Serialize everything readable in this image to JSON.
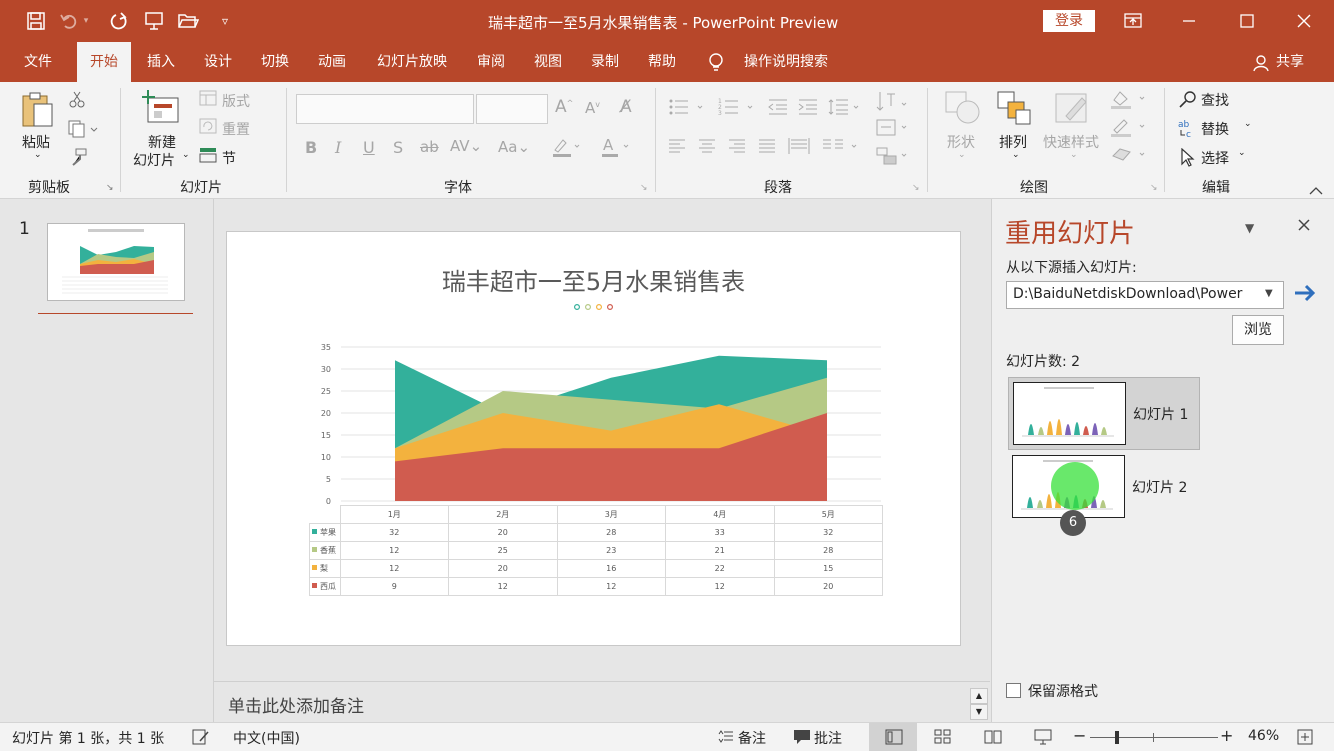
{
  "window": {
    "title": "瑞丰超市一至5月水果销售表 - PowerPoint Preview",
    "login_label": "登录"
  },
  "tabs": [
    "文件",
    "开始",
    "插入",
    "设计",
    "切换",
    "动画",
    "幻灯片放映",
    "审阅",
    "视图",
    "录制",
    "帮助"
  ],
  "tell_me": "操作说明搜索",
  "share": "共享",
  "ribbon": {
    "clipboard": {
      "paste": "粘贴",
      "label": "剪贴板"
    },
    "slides": {
      "new_slide_line1": "新建",
      "new_slide_line2": "幻灯片",
      "layout": "版式",
      "reset": "重置",
      "section": "节",
      "label": "幻灯片"
    },
    "font": {
      "label": "字体"
    },
    "paragraph": {
      "label": "段落"
    },
    "drawing": {
      "shapes": "形状",
      "arrange": "排列",
      "quick_styles": "快速样式",
      "label": "绘图"
    },
    "editing": {
      "find": "查找",
      "replace": "替换",
      "select": "选择",
      "label": "编辑"
    }
  },
  "thumbnail": {
    "number": "1"
  },
  "slide": {
    "title": "瑞丰超市一至5月水果销售表",
    "chart": {
      "y_ticks": [
        "0",
        "5",
        "10",
        "15",
        "20",
        "25",
        "30",
        "35"
      ],
      "months": [
        "1月",
        "2月",
        "3月",
        "4月",
        "5月"
      ],
      "series": [
        {
          "name": "苹果",
          "color": "#33b09b",
          "values": [
            32,
            20,
            28,
            33,
            32
          ]
        },
        {
          "name": "香蕉",
          "color": "#b5c985",
          "values": [
            12,
            25,
            23,
            21,
            28
          ]
        },
        {
          "name": "梨",
          "color": "#f3b23e",
          "values": [
            12,
            20,
            16,
            22,
            15
          ]
        },
        {
          "name": "西瓜",
          "color": "#d05c4f",
          "values": [
            9,
            12,
            12,
            12,
            20
          ]
        }
      ]
    }
  },
  "chart_data": {
    "type": "area",
    "title": "瑞丰超市一至5月水果销售表",
    "categories": [
      "1月",
      "2月",
      "3月",
      "4月",
      "5月"
    ],
    "series": [
      {
        "name": "苹果",
        "values": [
          32,
          20,
          28,
          33,
          32
        ]
      },
      {
        "name": "香蕉",
        "values": [
          12,
          25,
          23,
          21,
          28
        ]
      },
      {
        "name": "梨",
        "values": [
          12,
          20,
          16,
          22,
          15
        ]
      },
      {
        "name": "西瓜",
        "values": [
          9,
          12,
          12,
          12,
          20
        ]
      }
    ],
    "ylim": [
      0,
      35
    ],
    "grid": true,
    "legend": "data-table"
  },
  "notes": {
    "placeholder": "单击此处添加备注"
  },
  "reuse_pane": {
    "title": "重用幻灯片",
    "source_label": "从以下源插入幻灯片:",
    "source_path": "D:\\BaiduNetdiskDownload\\Power",
    "browse": "浏览",
    "count_label": "幻灯片数: 2",
    "slides": [
      "幻灯片 1",
      "幻灯片 2"
    ],
    "badge": "6",
    "keep_format": "保留源格式"
  },
  "status": {
    "slide_info": "幻灯片 第 1 张，共 1 张",
    "language": "中文(中国)",
    "notes": "备注",
    "comments": "批注",
    "zoom": "46%"
  },
  "colors": {
    "accent": "#b7472a"
  }
}
